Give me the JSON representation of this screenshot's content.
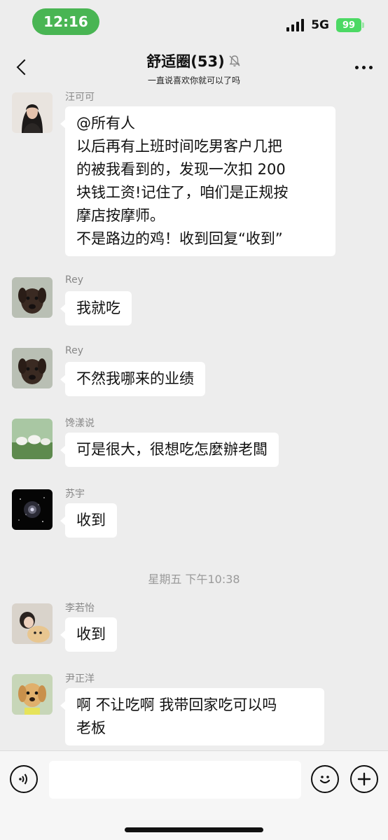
{
  "status_bar": {
    "time": "12:16",
    "network": "5G",
    "battery": "99"
  },
  "header": {
    "title": "舒适圈(53)",
    "subtitle": "一直说喜欢你就可以了吗",
    "icons": {
      "back": "chevron-left-icon",
      "mute": "bell-off-icon",
      "more": "more-dots-icon"
    }
  },
  "messages": [
    {
      "sender": "汪可可",
      "text": "@所有人\n以后再有上班时间吃男客户几把\n的被我看到的，发现一次扣 200\n块钱工资!记住了，咱们是正规按\n摩店按摩师。\n不是路边的鸡！收到回复“收到”"
    },
    {
      "sender": "Rey",
      "text": "我就吃"
    },
    {
      "sender": "Rey",
      "text": "不然我哪来的业绩"
    },
    {
      "sender": "馋漾说",
      "text": "可是很大，很想吃怎麼辦老闆"
    },
    {
      "sender": "苏宇",
      "text": "收到"
    },
    {
      "sender": "李若怡",
      "text": "收到"
    },
    {
      "sender": "尹正洋",
      "text": "啊 不让吃啊 我带回家吃可以吗\n老板"
    }
  ],
  "timestamp": "星期五 下午10:38",
  "input_bar": {
    "placeholder": "",
    "icons": {
      "voice": "voice-icon",
      "emoji": "emoji-icon",
      "plus": "plus-icon"
    }
  },
  "colors": {
    "background": "#ededed",
    "bubble": "#ffffff",
    "time_pill": "#49b553",
    "battery": "#4cd964",
    "muted_text": "#888888"
  }
}
